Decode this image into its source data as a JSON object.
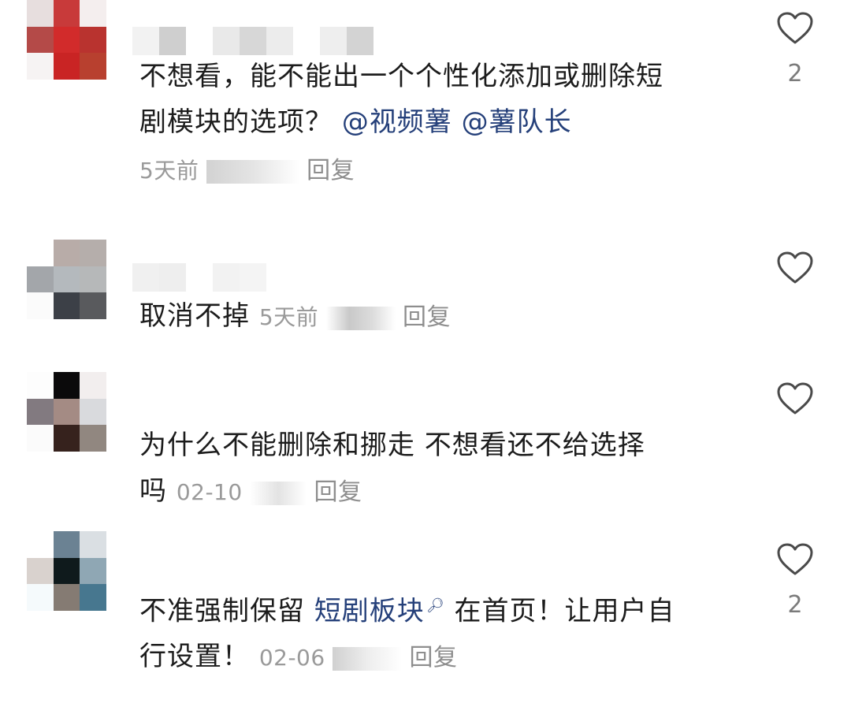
{
  "comments": [
    {
      "text": "不想看，能不能出一个个性化添加或删除短剧模块的选项？",
      "text_line1": "不想看，能不能出一个个性化添加或删除短",
      "text_line2": "剧模块的选项？",
      "mentions": [
        "@视频薯",
        "@薯队长"
      ],
      "time": "5天前",
      "reply_label": "回复",
      "likes": "2"
    },
    {
      "text": "取消不掉",
      "time": "5天前",
      "reply_label": "回复",
      "likes": ""
    },
    {
      "text_line1": "为什么不能删除和挪走 不想看还不给选择",
      "text_line2": "吗",
      "time": "02-10",
      "reply_label": "回复",
      "likes": ""
    },
    {
      "text_prefix": "不准强制保留 ",
      "topic_link": "短剧板块",
      "text_suffix": " 在首页！让用户自",
      "text_line2": "行设置！",
      "time": "02-06",
      "reply_label": "回复",
      "likes": "2"
    }
  ],
  "icons": {
    "like": "heart-outline-icon",
    "search": "search-icon"
  },
  "colors": {
    "mention": "#25407a",
    "meta": "#9a9a9a",
    "like_stroke": "#4a4a4a"
  }
}
